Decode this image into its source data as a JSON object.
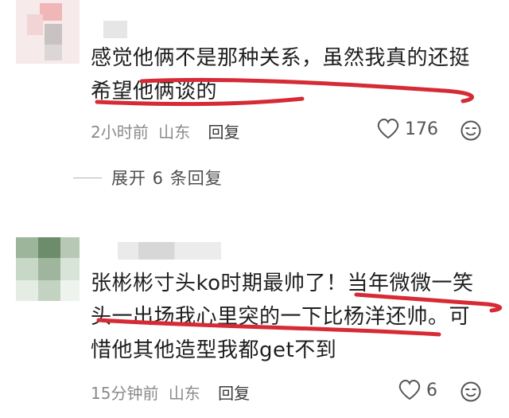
{
  "comments": [
    {
      "text_line1": "感觉他俩不是那种关系，虽然我真的还挺",
      "text_line2": "希望他俩谈的",
      "time": "2小时前",
      "location": "山东",
      "reply_label": "回复",
      "likes": "176",
      "avatar_icon": "avatar-blurred",
      "like_icon": "heart-outline-icon",
      "emoji_icon": "emoji-face-icon"
    },
    {
      "text_line1": "张彬彬寸头ko时期最帅了！当年微微一笑",
      "text_line2": "头一出场我心里突的一下比杨洋还帅。可",
      "text_line3": "惜他其他造型我都get不到",
      "time": "15分钟前",
      "location": "山东",
      "reply_label": "回复",
      "likes": "6",
      "avatar_icon": "avatar-blurred",
      "like_icon": "heart-outline-icon",
      "emoji_icon": "emoji-face-icon"
    }
  ],
  "expand_replies": "展开 6 条回复",
  "colors": {
    "underline": "#d62a35",
    "meta": "#8a8a8a",
    "text": "#1e1e1e"
  }
}
